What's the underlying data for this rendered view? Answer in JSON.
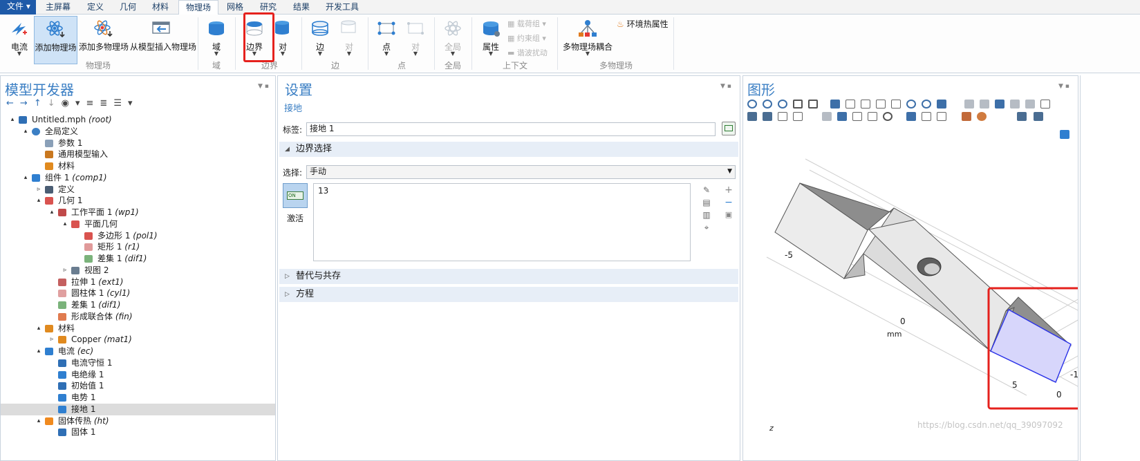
{
  "menu": {
    "file": "文件 ▾",
    "tabs": [
      "主屏幕",
      "定义",
      "几何",
      "材料",
      "物理场",
      "网格",
      "研究",
      "结果",
      "开发工具"
    ],
    "active_tab_index": 4
  },
  "ribbon": {
    "buttons": {
      "current": "电流",
      "add_physics": "添加物理场",
      "add_multiphysics": "添加多物理场",
      "insert_from_model": "从模型插入物理场",
      "domain": "域",
      "boundary": "边界",
      "pair": "对",
      "edge": "边",
      "edge_pair": "对",
      "point": "点",
      "point_pair": "对",
      "global": "全局",
      "properties": "属性",
      "multiphysics_coupling": "多物理场耦合"
    },
    "small": {
      "load_group": "载荷组 ▾",
      "constraint_group": "约束组 ▾",
      "harmonic_perturbation": "谐波扰动",
      "ambient_thermal": "环境热属性"
    },
    "groups": [
      "物理场",
      "域",
      "边界",
      "边",
      "点",
      "全局",
      "上下文",
      "多物理场"
    ]
  },
  "model_builder": {
    "title": "模型开发器",
    "tree": [
      {
        "label": "Untitled.mph",
        "tag": "(root)",
        "level": 0,
        "exp": "▴",
        "icon": "model-icon"
      },
      {
        "label": "全局定义",
        "tag": "",
        "level": 1,
        "exp": "▴",
        "icon": "globe-icon"
      },
      {
        "label": "参数 1",
        "tag": "",
        "level": 2,
        "exp": "",
        "icon": "parameter-icon"
      },
      {
        "label": "通用模型输入",
        "tag": "",
        "level": 2,
        "exp": "",
        "icon": "model-input-icon"
      },
      {
        "label": "材料",
        "tag": "",
        "level": 2,
        "exp": "",
        "icon": "material-icon"
      },
      {
        "label": "组件 1",
        "tag": "(comp1)",
        "level": 1,
        "exp": "▴",
        "icon": "component-icon"
      },
      {
        "label": "定义",
        "tag": "",
        "level": 2,
        "exp": "▹",
        "icon": "definitions-icon"
      },
      {
        "label": "几何 1",
        "tag": "",
        "level": 2,
        "exp": "▴",
        "icon": "geometry-icon"
      },
      {
        "label": "工作平面 1",
        "tag": "(wp1)",
        "level": 3,
        "exp": "▴",
        "icon": "workplane-icon"
      },
      {
        "label": "平面几何",
        "tag": "",
        "level": 4,
        "exp": "▴",
        "icon": "geometry-icon"
      },
      {
        "label": "多边形 1",
        "tag": "(pol1)",
        "level": 5,
        "exp": "",
        "icon": "polygon-icon"
      },
      {
        "label": "矩形 1",
        "tag": "(r1)",
        "level": 5,
        "exp": "",
        "icon": "rectangle-icon"
      },
      {
        "label": "差集 1",
        "tag": "(dif1)",
        "level": 5,
        "exp": "",
        "icon": "difference-icon"
      },
      {
        "label": "视图 2",
        "tag": "",
        "level": 4,
        "exp": "▹",
        "icon": "view-icon"
      },
      {
        "label": "拉伸 1",
        "tag": "(ext1)",
        "level": 3,
        "exp": "",
        "icon": "extrude-icon"
      },
      {
        "label": "圆柱体 1",
        "tag": "(cyl1)",
        "level": 3,
        "exp": "",
        "icon": "cylinder-icon"
      },
      {
        "label": "差集 1",
        "tag": "(dif1)",
        "level": 3,
        "exp": "",
        "icon": "difference-icon"
      },
      {
        "label": "形成联合体",
        "tag": "(fin)",
        "level": 3,
        "exp": "",
        "icon": "form-union-icon"
      },
      {
        "label": "材料",
        "tag": "",
        "level": 2,
        "exp": "▴",
        "icon": "material-icon"
      },
      {
        "label": "Copper",
        "tag": "(mat1)",
        "level": 3,
        "exp": "▹",
        "icon": "material-icon"
      },
      {
        "label": "电流",
        "tag": "(ec)",
        "level": 2,
        "exp": "▴",
        "icon": "electric-current-icon"
      },
      {
        "label": "电流守恒 1",
        "tag": "",
        "level": 3,
        "exp": "",
        "icon": "domain-feature-icon"
      },
      {
        "label": "电绝缘 1",
        "tag": "",
        "level": 3,
        "exp": "",
        "icon": "boundary-feature-icon"
      },
      {
        "label": "初始值 1",
        "tag": "",
        "level": 3,
        "exp": "",
        "icon": "domain-feature-icon"
      },
      {
        "label": "电势 1",
        "tag": "",
        "level": 3,
        "exp": "",
        "icon": "boundary-feature-icon"
      },
      {
        "label": "接地 1",
        "tag": "",
        "level": 3,
        "exp": "",
        "icon": "boundary-feature-icon",
        "selected": true
      },
      {
        "label": "固体传热",
        "tag": "(ht)",
        "level": 2,
        "exp": "▴",
        "icon": "heat-transfer-icon"
      },
      {
        "label": "固体 1",
        "tag": "",
        "level": 3,
        "exp": "",
        "icon": "domain-feature-icon"
      }
    ]
  },
  "settings": {
    "title": "设置",
    "subtitle": "接地",
    "label_caption": "标签:",
    "label_value": "接地 1",
    "boundary_section": "边界选择",
    "selection_caption": "选择:",
    "selection_value": "手动",
    "selection_list": [
      "13"
    ],
    "activate_badge": "ON",
    "activate_caption": "激活",
    "override_section": "替代与共存",
    "equation_section": "方程"
  },
  "graphics": {
    "title": "图形",
    "axis_labels": [
      "-5",
      "0",
      "mm",
      "5",
      "0",
      "-1"
    ],
    "triad_label": "z",
    "watermark": "https://blog.csdn.net/qq_39097092",
    "highlight_color": "#d7d6fb"
  },
  "colors": {
    "accent": "#3b7fc4",
    "highlight_red": "#e5211d",
    "section_bg": "#e7eef7"
  }
}
